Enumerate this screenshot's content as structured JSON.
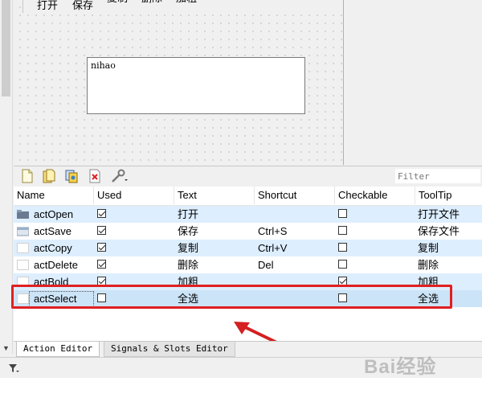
{
  "menu": {
    "open": "打开",
    "save": "保存",
    "copy": "复制",
    "delete": "删除",
    "bold": "加粗"
  },
  "form": {
    "textbox_value": "nihao"
  },
  "toolbar": {
    "icons": [
      "new-action-icon",
      "new-folder-icon",
      "copy-icon",
      "delete-icon",
      "configure-icon"
    ],
    "filter_placeholder": "Filter"
  },
  "table": {
    "columns": [
      "Name",
      "Used",
      "Text",
      "Shortcut",
      "Checkable",
      "ToolTip"
    ],
    "rows": [
      {
        "name": "actOpen",
        "used": true,
        "text": "打开",
        "shortcut": "",
        "checkable": false,
        "tooltip": "打开文件",
        "icon": "folder-icon"
      },
      {
        "name": "actSave",
        "used": true,
        "text": "保存",
        "shortcut": "Ctrl+S",
        "checkable": false,
        "tooltip": "保存文件",
        "icon": "save-icon"
      },
      {
        "name": "actCopy",
        "used": true,
        "text": "复制",
        "shortcut": "Ctrl+V",
        "checkable": false,
        "tooltip": "复制",
        "icon": ""
      },
      {
        "name": "actDelete",
        "used": true,
        "text": "删除",
        "shortcut": "Del",
        "checkable": false,
        "tooltip": "删除",
        "icon": ""
      },
      {
        "name": "actBold",
        "used": true,
        "text": "加粗",
        "shortcut": "",
        "checkable": true,
        "tooltip": "加粗",
        "icon": ""
      },
      {
        "name": "actSelect",
        "used": false,
        "text": "全选",
        "shortcut": "",
        "checkable": false,
        "tooltip": "全选",
        "icon": ""
      }
    ]
  },
  "tabs": {
    "action_editor": "Action Editor",
    "signals_slots": "Signals & Slots Editor"
  },
  "watermark": {
    "text": "Bai经验"
  },
  "colors": {
    "highlight": "#e02020",
    "row_alt": "#ddeeff",
    "row_selected": "#cce4f7",
    "arrow": "#d42020"
  }
}
